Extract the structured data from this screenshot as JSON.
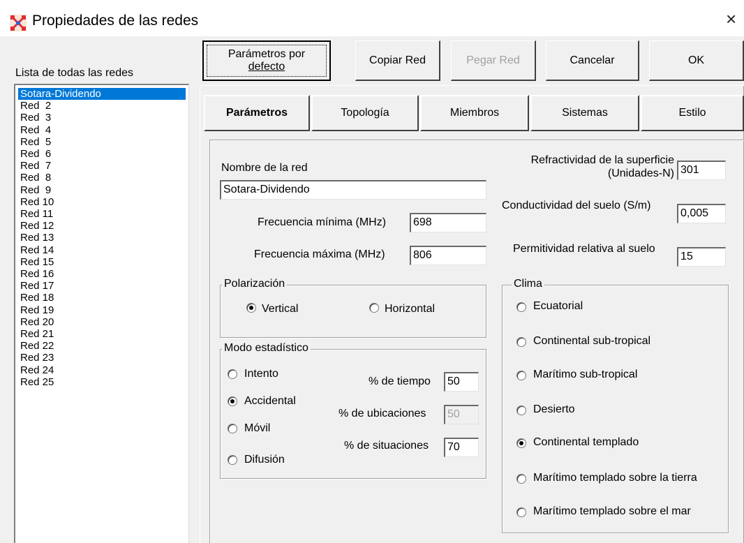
{
  "window": {
    "title": "Propiedades de las redes",
    "icon": "network-app-icon",
    "close_glyph": "×"
  },
  "left": {
    "list_label": "Lista de todas las redes",
    "items": [
      "Sotara-Dividendo",
      "Red  2",
      "Red  3",
      "Red  4",
      "Red  5",
      "Red  6",
      "Red  7",
      "Red  8",
      "Red  9",
      "Red 10",
      "Red 11",
      "Red 12",
      "Red 13",
      "Red 14",
      "Red 15",
      "Red 16",
      "Red 17",
      "Red 18",
      "Red 19",
      "Red 20",
      "Red 21",
      "Red 22",
      "Red 23",
      "Red 24",
      "Red 25"
    ],
    "selected": "Sotara-Dividendo"
  },
  "toolbar": {
    "defaults_line1": "Parámetros por",
    "defaults_line2": "defecto",
    "copy": "Copiar Red",
    "paste": "Pegar Red",
    "cancel": "Cancelar",
    "ok": "OK"
  },
  "tabs": {
    "params": "Parámetros",
    "topology": "Topología",
    "members": "Miembros",
    "systems": "Sistemas",
    "style": "Estilo",
    "active": "Parámetros"
  },
  "params": {
    "name_label": "Nombre de la red",
    "name_value": "Sotara-Dividendo",
    "freq_min_label": "Frecuencia mínima (MHz)",
    "freq_min_value": "698",
    "freq_max_label": "Frecuencia máxima (MHz)",
    "freq_max_value": "806",
    "refractivity_label_1": "Refractividad de la superficie",
    "refractivity_label_2": "(Unidades-N)",
    "refractivity_value": "301",
    "conductivity_label": "Conductividad del suelo (S/m)",
    "conductivity_value": "0,005",
    "permittivity_label": "Permitividad relativa al suelo",
    "permittivity_value": "15"
  },
  "polarization": {
    "title": "Polarización",
    "vertical": "Vertical",
    "horizontal": "Horizontal",
    "selected": "Vertical"
  },
  "stat_mode": {
    "title": "Modo estadístico",
    "intento": "Intento",
    "accidental": "Accidental",
    "movil": "Móvil",
    "difusion": "Difusión",
    "selected": "Accidental",
    "time_label": "% de tiempo",
    "time_value": "50",
    "locations_label": "% de ubicaciones",
    "locations_value": "50",
    "situations_label": "% de situaciones",
    "situations_value": "70"
  },
  "climate": {
    "title": "Clima",
    "ecuatorial": "Ecuatorial",
    "cont_subtrop": "Continental sub-tropical",
    "mar_subtrop": "Marítimo sub-tropical",
    "desierto": "Desierto",
    "cont_templ": "Continental templado",
    "mar_templ_tierra": "Marítimo templado sobre la tierra",
    "mar_templ_mar": "Marítimo templado sobre el mar",
    "selected": "Continental templado"
  },
  "colors": {
    "selection": "#0078d7",
    "face": "#f0f0f0",
    "disabled_text": "#a0a0a0"
  }
}
